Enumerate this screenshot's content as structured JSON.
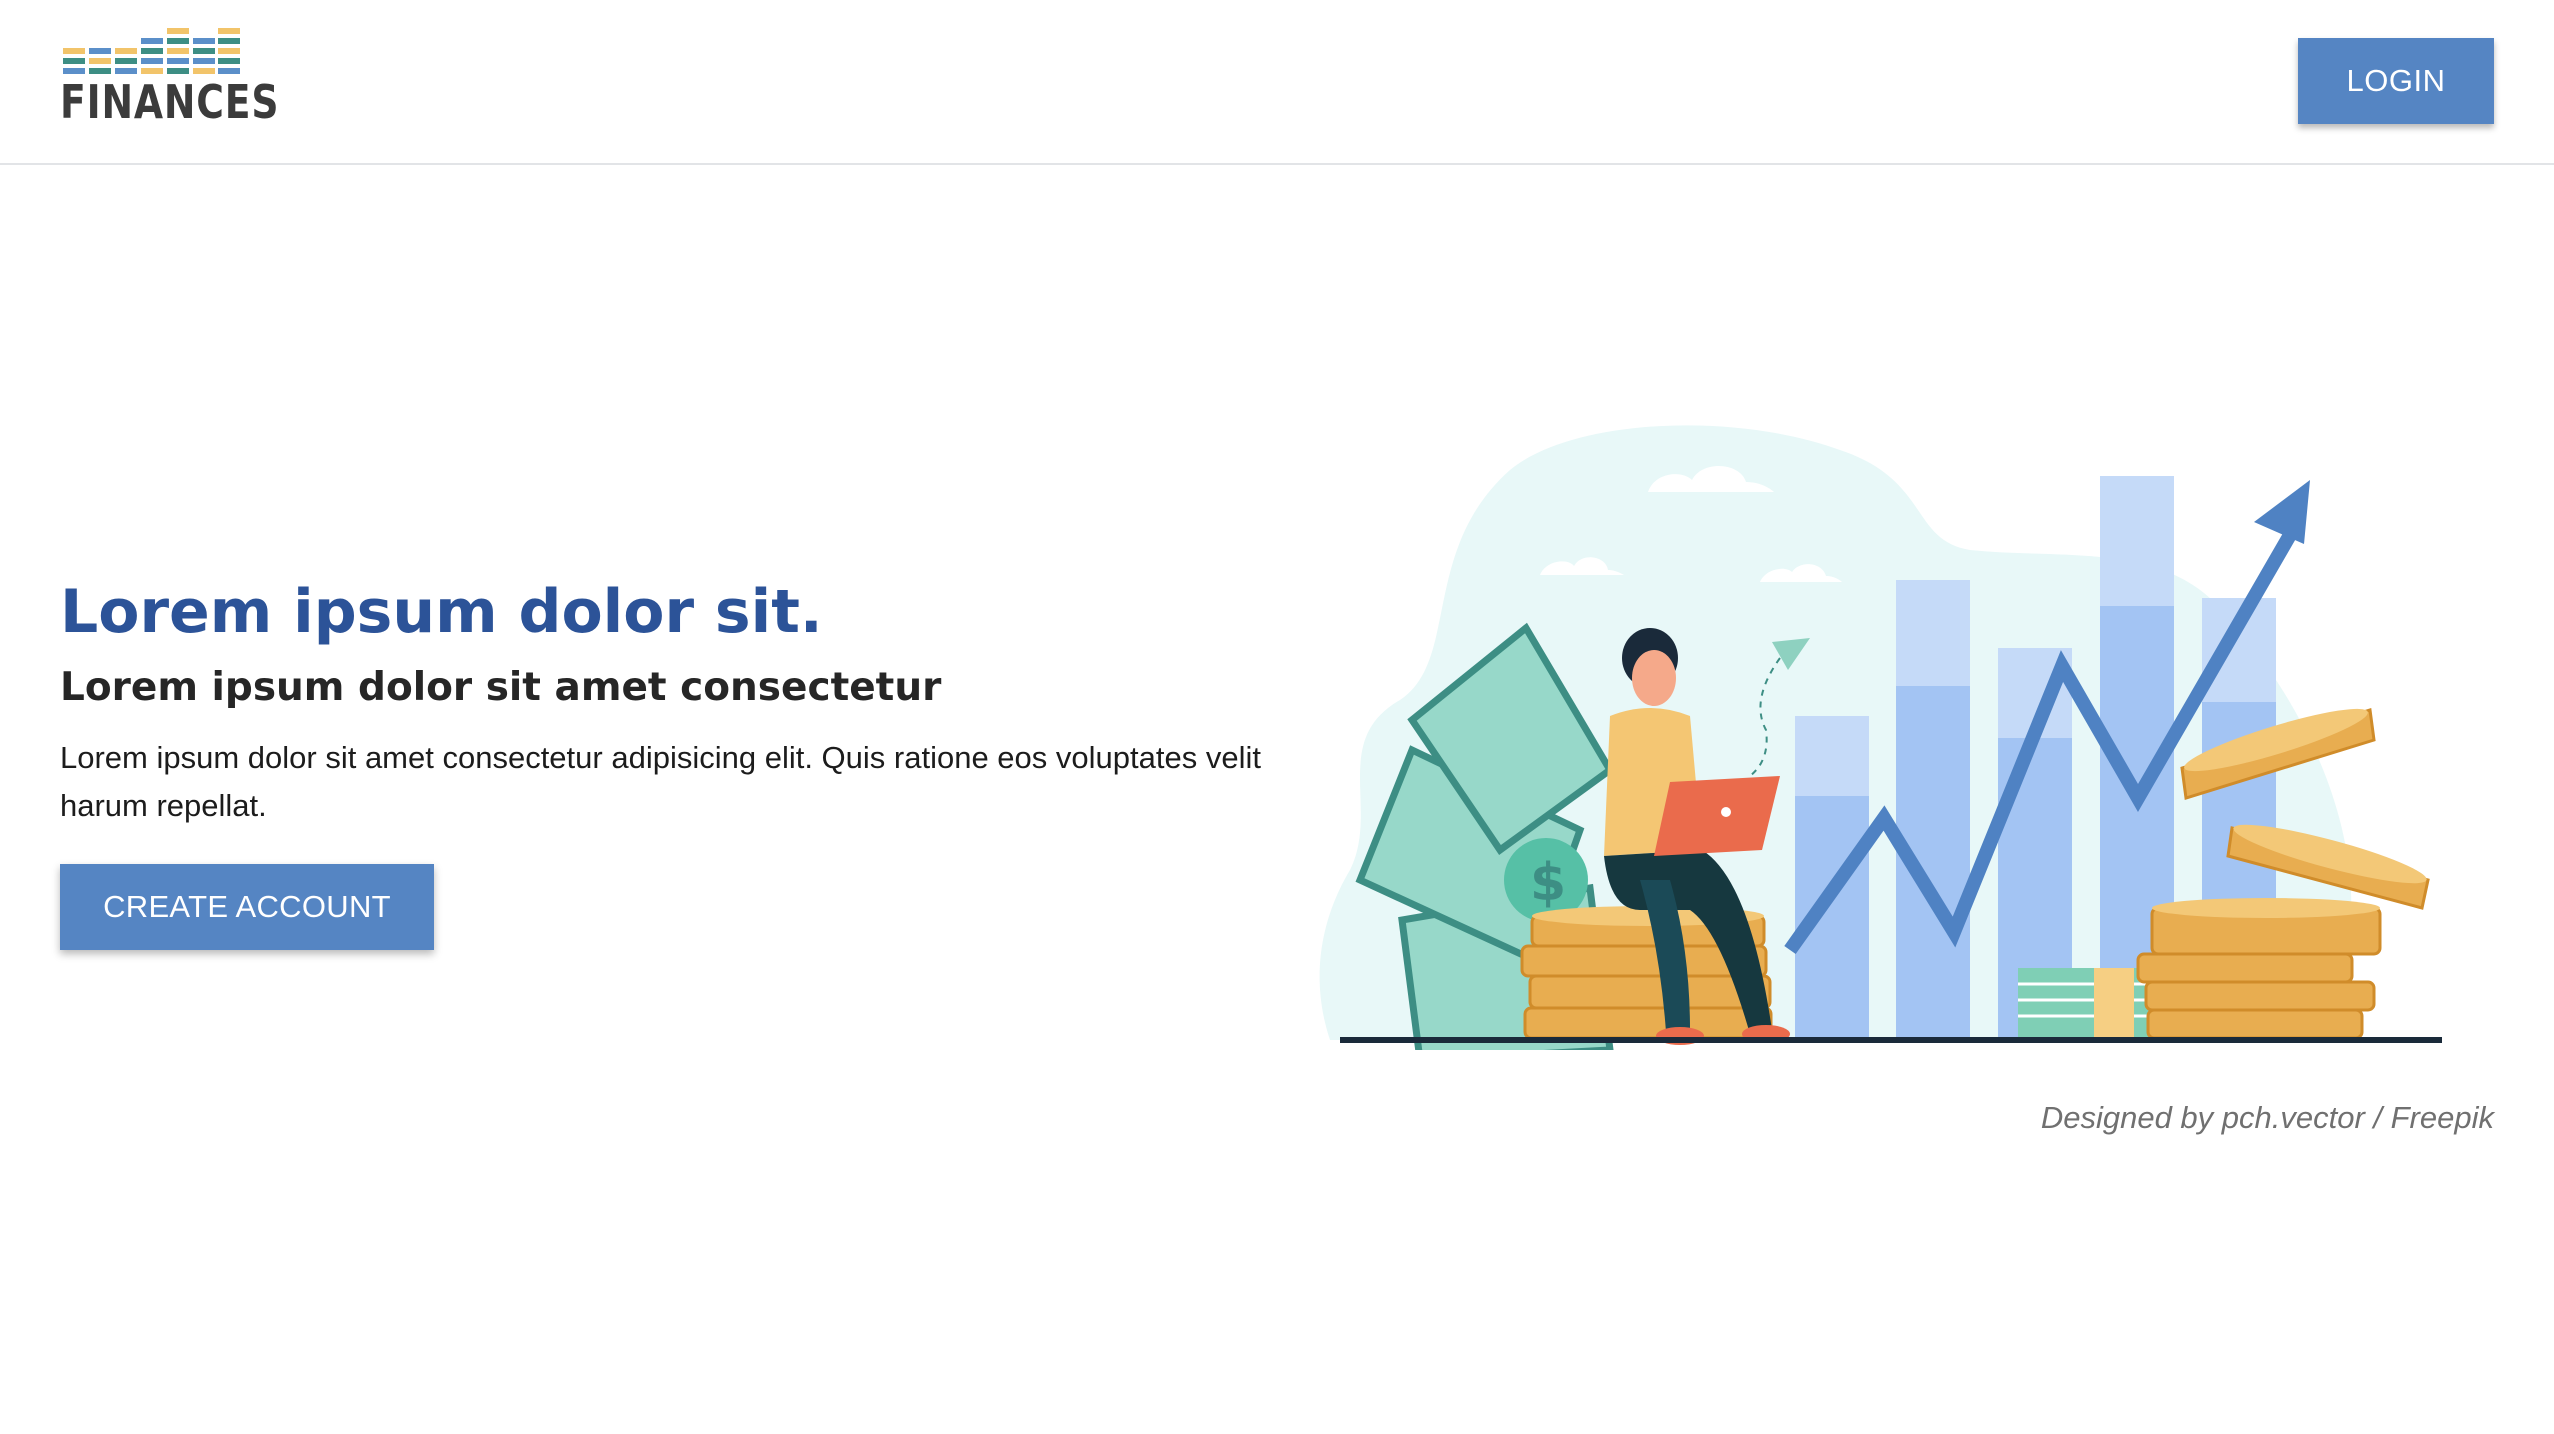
{
  "header": {
    "logo_text": "FINANCES",
    "login_label": "LOGIN"
  },
  "hero": {
    "title": "Lorem ipsum dolor sit.",
    "subtitle": "Lorem ipsum dolor sit amet consectetur",
    "body": "Lorem ipsum dolor sit amet consectetur adipisicing elit. Quis ratione eos voluptates velit harum repellat.",
    "cta_label": "CREATE ACCOUNT"
  },
  "illustration": {
    "credit": "Designed by pch.vector / Freepik"
  },
  "colors": {
    "brand_blue": "#5585c3",
    "title_blue": "#2c5398",
    "logo_teal": "#3d8e84",
    "logo_yellow": "#f2c46a",
    "logo_blue": "#5b8fc9"
  },
  "icons": [
    "finances-logo",
    "finance-growth-illustration"
  ]
}
